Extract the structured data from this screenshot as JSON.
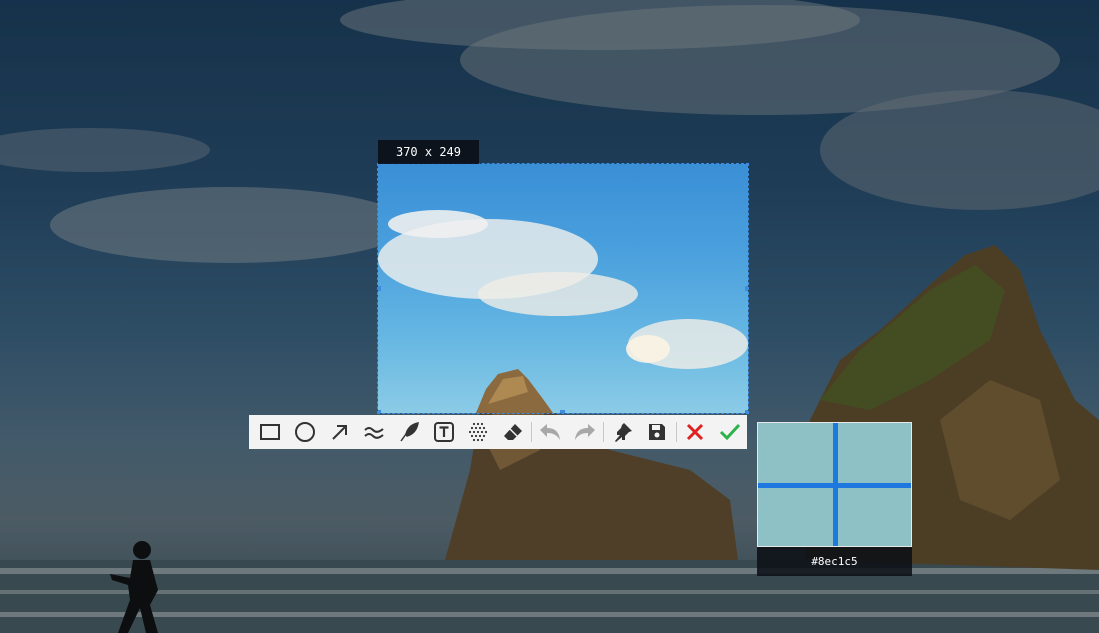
{
  "selection": {
    "size_text": "370 x 249"
  },
  "toolbar": {
    "tools": [
      {
        "name": "rectangle-tool",
        "icon": "rectangle-icon"
      },
      {
        "name": "ellipse-tool",
        "icon": "ellipse-icon"
      },
      {
        "name": "arrow-tool",
        "icon": "arrow-icon"
      },
      {
        "name": "pen-tool",
        "icon": "wave-icon"
      },
      {
        "name": "marker-tool",
        "icon": "feather-icon"
      },
      {
        "name": "text-tool",
        "icon": "text-icon"
      },
      {
        "name": "mosaic-tool",
        "icon": "mosaic-icon"
      },
      {
        "name": "eraser-tool",
        "icon": "eraser-icon"
      },
      {
        "name": "undo-button",
        "icon": "undo-icon"
      },
      {
        "name": "redo-button",
        "icon": "redo-icon"
      },
      {
        "name": "pin-button",
        "icon": "pin-icon"
      },
      {
        "name": "save-button",
        "icon": "save-icon"
      },
      {
        "name": "cancel-button",
        "icon": "close-icon"
      },
      {
        "name": "confirm-button",
        "icon": "check-icon"
      }
    ],
    "colors": {
      "icon": "#333333",
      "disabled": "#a8a8a8",
      "cancel": "#e02020",
      "confirm": "#2db24a"
    }
  },
  "magnifier": {
    "color_hex": "#8ec1c5"
  }
}
